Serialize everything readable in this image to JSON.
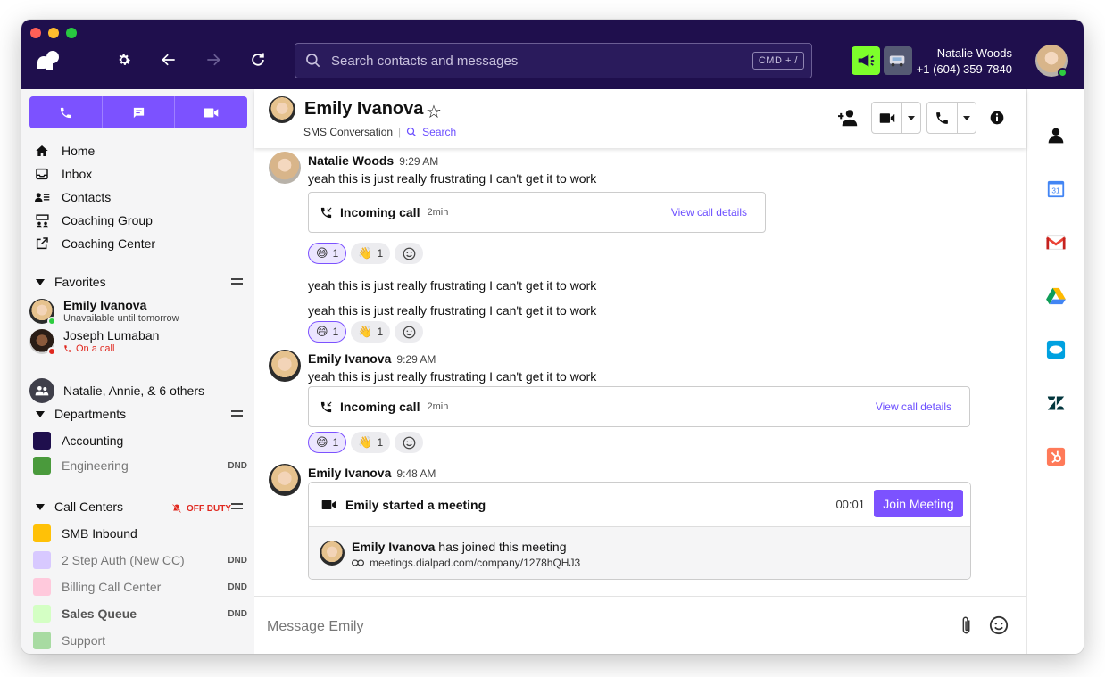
{
  "window": {
    "dot_colors": [
      "#ff5f57",
      "#febc2e",
      "#28c840"
    ]
  },
  "topbar": {
    "search_placeholder": "Search contacts and messages",
    "shortcut": "CMD + /",
    "user_name": "Natalie Woods",
    "user_phone": "+1 (604) 359-7840",
    "icons": [
      "settings-icon",
      "back-arrow-icon",
      "forward-arrow-icon",
      "refresh-icon",
      "megaphone-icon",
      "van-icon"
    ]
  },
  "sidebar": {
    "nav": [
      {
        "label": "Home",
        "icon": "home-icon"
      },
      {
        "label": "Inbox",
        "icon": "inbox-icon"
      },
      {
        "label": "Contacts",
        "icon": "contacts-icon"
      },
      {
        "label": "Coaching Group",
        "icon": "coaching-group-icon"
      },
      {
        "label": "Coaching Center",
        "icon": "external-link-icon"
      }
    ],
    "favorites_title": "Favorites",
    "favorites": [
      {
        "name": "Emily Ivanova",
        "status": "Unavailable until tomorrow"
      },
      {
        "name": "Joseph Lumaban",
        "status": "On a call"
      },
      {
        "name": "Natalie, Annie, & 6 others"
      }
    ],
    "departments_title": "Departments",
    "departments": [
      {
        "label": "Accounting",
        "color": "#1f0f4d"
      },
      {
        "label": "Engineering",
        "badge": "DND",
        "color": "#4a9a3c"
      }
    ],
    "call_centers_title": "Call Centers",
    "off_duty": "OFF DUTY",
    "call_centers": [
      {
        "label": "SMB Inbound",
        "color": "#ffc107"
      },
      {
        "label": "2 Step Auth (New CC)",
        "badge": "DND",
        "color": "#d8c9ff"
      },
      {
        "label": "Billing Call Center",
        "badge": "DND",
        "color": "#ffc9dc"
      },
      {
        "label": "Sales Queue",
        "badge": "DND",
        "color": "#d4ffc4"
      },
      {
        "label": "Support",
        "color": "#a8dba2"
      }
    ]
  },
  "header": {
    "title": "Emily Ivanova",
    "subtitle": "SMS Conversation",
    "search_label": "Search"
  },
  "messages": {
    "m1": {
      "name": "Natalie Woods",
      "time": "9:29 AM",
      "text": "yeah this is just really frustrating I can't get it to work"
    },
    "call1": {
      "label": "Incoming call",
      "duration": "2min",
      "link": "View call details"
    },
    "r1": {
      "smile": "1",
      "wave": "1"
    },
    "m2": {
      "text": "yeah this is just really frustrating I can't get it to work"
    },
    "m3": {
      "text": "yeah this is just really frustrating I can't get it to work"
    },
    "r2": {
      "smile": "1",
      "wave": "1"
    },
    "m4": {
      "name": "Emily Ivanova",
      "time": "9:29 AM",
      "text": "yeah this is just really frustrating I can't get it to work"
    },
    "call2": {
      "label": "Incoming call",
      "duration": "2min",
      "link": "View call details"
    },
    "r3": {
      "smile": "1",
      "wave": "1"
    },
    "m5": {
      "name": "Emily Ivanova",
      "time": "9:48 AM"
    },
    "meeting": {
      "title": "Emily started a meeting",
      "duration": "00:01",
      "join_label": "Join Meeting",
      "joined_name": "Emily Ivanova",
      "joined_text": " has joined this meeting",
      "link": "meetings.dialpad.com/company/1278hQHJ3"
    }
  },
  "composer": {
    "placeholder": "Message Emily"
  },
  "rail": {
    "icons": [
      "contact-icon",
      "google-calendar-icon",
      "gmail-icon",
      "google-drive-icon",
      "salesforce-icon",
      "zendesk-icon",
      "hubspot-icon"
    ]
  },
  "colors": {
    "brand": "#7c52ff",
    "topbar": "#1f0f4d",
    "megaphone_btn": "#7dff2b"
  }
}
